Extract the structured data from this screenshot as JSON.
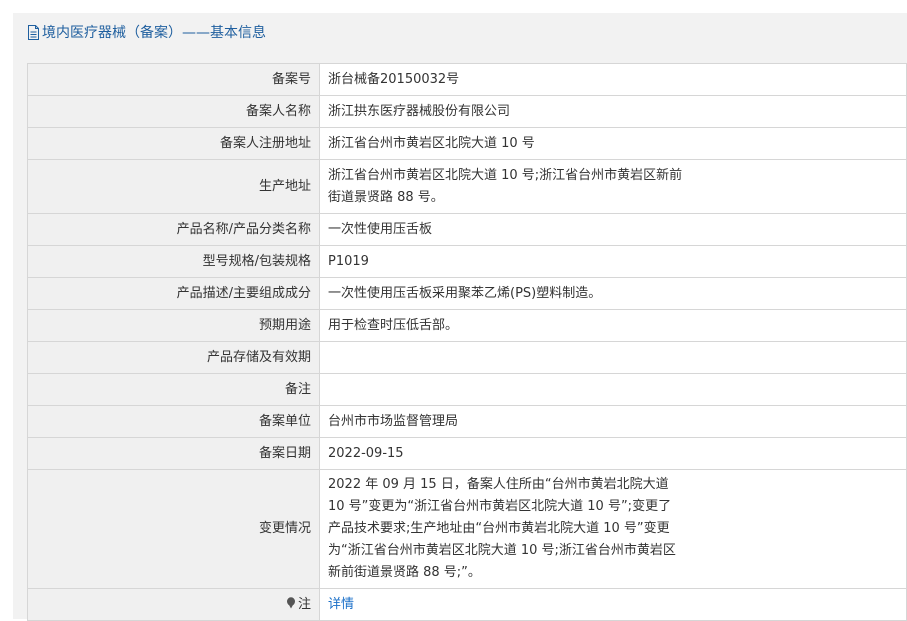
{
  "header": {
    "title": "境内医疗器械（备案）——基本信息"
  },
  "rows": [
    {
      "label": "备案号",
      "value": "浙台械备20150032号"
    },
    {
      "label": "备案人名称",
      "value": "浙江拱东医疗器械股份有限公司"
    },
    {
      "label": "备案人注册地址",
      "value": "浙江省台州市黄岩区北院大道 10 号"
    },
    {
      "label": "生产地址",
      "value": "浙江省台州市黄岩区北院大道 10 号;浙江省台州市黄岩区新前街道景贤路 88 号。"
    },
    {
      "label": "产品名称/产品分类名称",
      "value": "一次性使用压舌板"
    },
    {
      "label": "型号规格/包装规格",
      "value": "P1019"
    },
    {
      "label": "产品描述/主要组成成分",
      "value": "一次性使用压舌板采用聚苯乙烯(PS)塑料制造。"
    },
    {
      "label": "预期用途",
      "value": "用于检查时压低舌部。"
    },
    {
      "label": "产品存储及有效期",
      "value": ""
    },
    {
      "label": "备注",
      "value": ""
    },
    {
      "label": "备案单位",
      "value": "台州市市场监督管理局"
    },
    {
      "label": "备案日期",
      "value": "2022-09-15"
    },
    {
      "label": "变更情况",
      "value": "2022 年 09 月 15 日，备案人住所由“台州市黄岩北院大道 10 号”变更为“浙江省台州市黄岩区北院大道 10 号”;变更了产品技术要求;生产地址由“台州市黄岩北院大道 10 号”变更为“浙江省台州市黄岩区北院大道 10 号;浙江省台州市黄岩区新前街道景贤路 88 号;”。"
    }
  ],
  "note": {
    "label": "注",
    "link_text": "详情",
    "icon": "pin-icon"
  }
}
